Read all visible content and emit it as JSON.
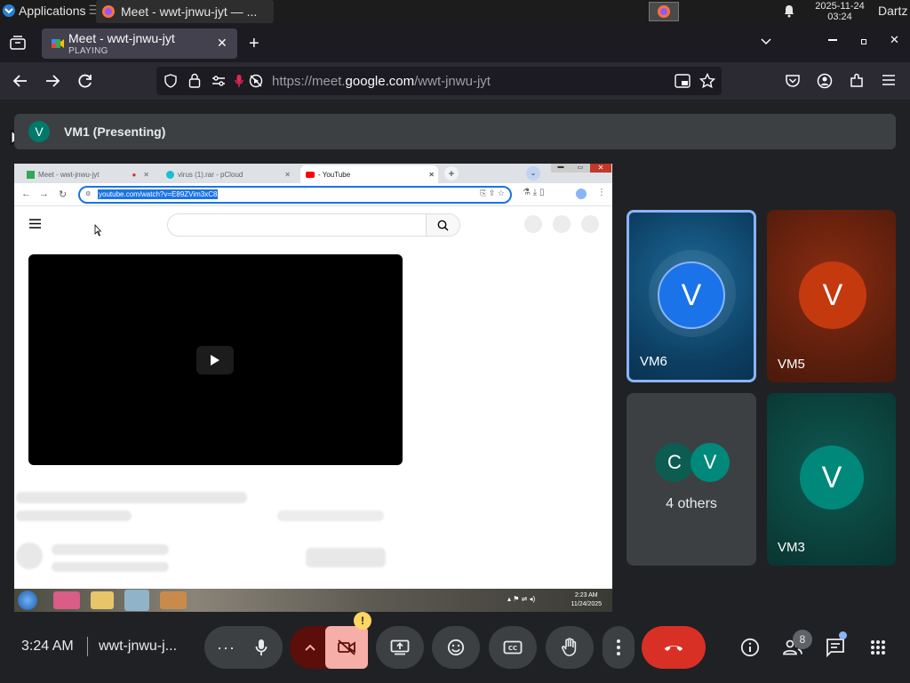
{
  "os_bar": {
    "applications_label": "Applications",
    "task_title": "Meet - wwt-jnwu-jyt — ...",
    "clock_date": "2025-11-24",
    "clock_time": "03:24",
    "user": "Dartz"
  },
  "browser": {
    "tab_title": "Meet - wwt-jnwu-jyt",
    "tab_status": "PLAYING",
    "url_prefix": "https://meet.",
    "url_domain": "google.com",
    "url_path": "/wwt-jnwu-jyt"
  },
  "meet": {
    "presenter_avatar": "V",
    "presenter_label": "VM1 (Presenting)",
    "shared_screen": {
      "tabs": [
        {
          "label": "Meet - wwt-jnwu-jyt"
        },
        {
          "label": "virus (1).rar - pCloud"
        },
        {
          "label": "- YouTube"
        }
      ],
      "omnibox_text": "youtube.com/watch?v=E89ZVim3xC8",
      "win_clock_time": "2:23 AM",
      "win_clock_date": "11/24/2025"
    },
    "tiles": [
      {
        "avatar": "V",
        "name": "VM6",
        "avatar_color": "#1a73e8"
      },
      {
        "avatar": "V",
        "name": "VM5",
        "avatar_color": "#c5390f"
      },
      {
        "avatars": [
          "C",
          "V"
        ],
        "label": "4 others"
      },
      {
        "avatar": "V",
        "name": "VM3",
        "avatar_color": "#00897b"
      }
    ],
    "controls": {
      "time": "3:24 AM",
      "meeting_code": "wwt-jnwu-j...",
      "camera_warning": "!",
      "people_count": "8"
    }
  },
  "colors": {
    "accent_blue": "#8ab4f8",
    "leave_red": "#d93025",
    "camera_off_bg": "#f6aea9"
  }
}
